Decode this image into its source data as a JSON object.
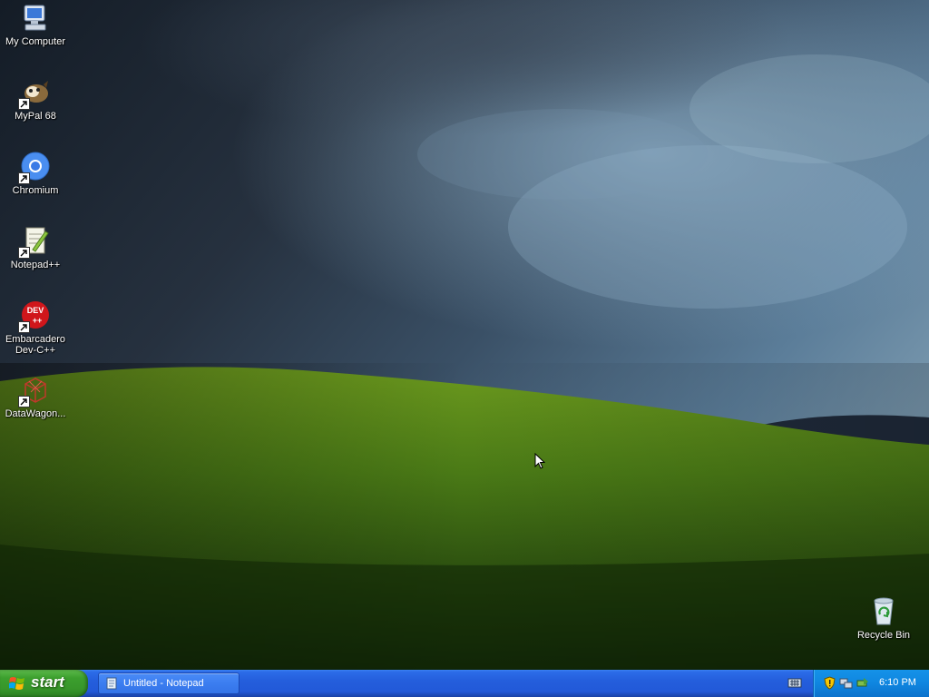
{
  "desktop": {
    "icons": [
      {
        "label": "My Computer",
        "icon": "my-computer-icon"
      },
      {
        "label": "MyPal 68",
        "icon": "mypal-icon"
      },
      {
        "label": "Chromium",
        "icon": "chromium-icon"
      },
      {
        "label": "Notepad++",
        "icon": "notepadpp-icon"
      },
      {
        "label": "Embarcadero\nDev-C++",
        "icon": "devcpp-icon"
      },
      {
        "label": "DataWagon...",
        "icon": "datawagon-icon"
      }
    ],
    "recycle_bin": {
      "label": "Recycle Bin",
      "icon": "recycle-bin-icon"
    }
  },
  "taskbar": {
    "start_label": "start",
    "tasks": [
      {
        "label": "Untitled - Notepad",
        "icon": "notepad-icon"
      }
    ],
    "clock": "6:10 PM"
  },
  "colors": {
    "taskbar_blue": "#245edc",
    "start_green": "#3c9f2e",
    "tray_blue": "#0f86e0"
  }
}
